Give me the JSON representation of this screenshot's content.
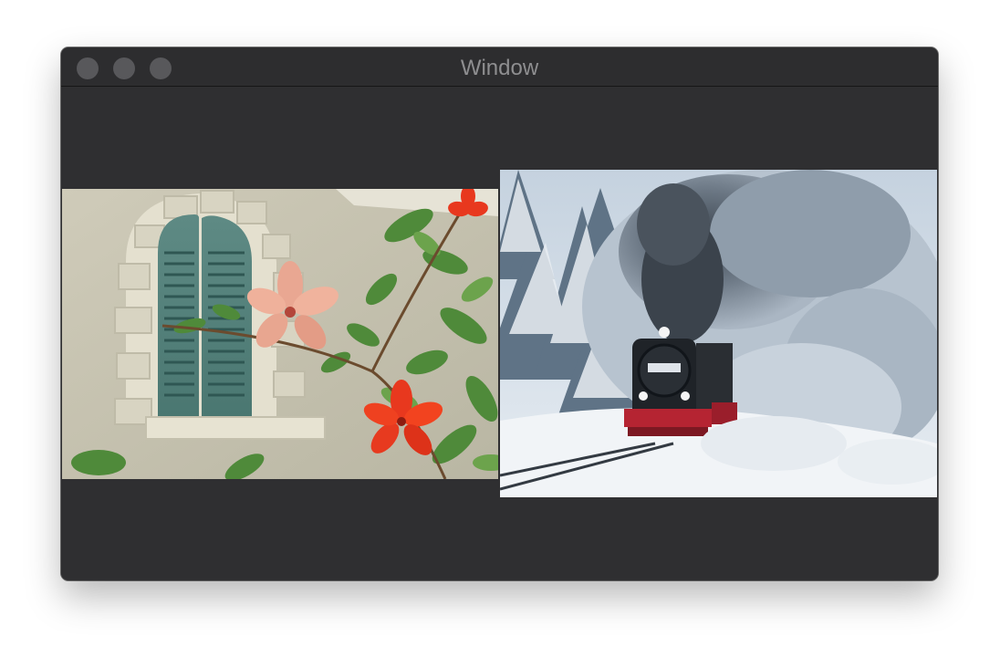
{
  "window": {
    "title": "Window"
  },
  "images": [
    {
      "name": "hibiscus-window-photo"
    },
    {
      "name": "steam-locomotive-snow-photo"
    }
  ],
  "colors": {
    "window_bg": "#2f2f31",
    "titlebar_bg": "#2d2d2f",
    "traffic_light": "#58585b",
    "title_text": "#8e8e90"
  }
}
